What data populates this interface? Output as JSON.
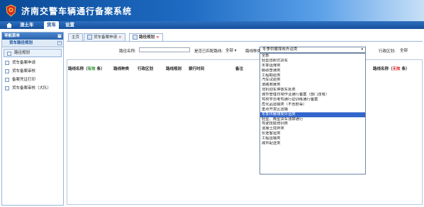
{
  "app": {
    "title": "济南交警车辆通行备案系统"
  },
  "nav": {
    "items": [
      {
        "label": "渣土车",
        "active": false
      },
      {
        "label": "货车",
        "active": true
      },
      {
        "label": "设置",
        "active": false
      }
    ]
  },
  "sidebar": {
    "header": "导航菜单",
    "section": "货车路径规划",
    "items": [
      {
        "label": "路径规划",
        "active": true
      },
      {
        "label": "货车备案申请"
      },
      {
        "label": "货车备案审核"
      },
      {
        "label": "备案凭证打印"
      },
      {
        "label": "货车备案审核（大队）"
      }
    ]
  },
  "tabs": [
    {
      "label": "主页",
      "closable": false
    },
    {
      "label": "货车备案申请",
      "closable": true
    },
    {
      "label": "路径规划",
      "closable": true,
      "active": true
    }
  ],
  "filters": {
    "route_name_label": "路径名称:",
    "match_label": "是否已匹配路线:",
    "match_value": "全部",
    "type_label": "路线种类:",
    "type_value": "冬季供暖煤炭外运类",
    "district_label": "行政区划:",
    "district_value": "全部"
  },
  "grid": {
    "col_route_name_prefix": "路线名称（",
    "col_route_name_valid": "有效",
    "col_route_name_suffix": " 条）",
    "col_type": "路线种类",
    "col_district": "行政区划",
    "col_rule": "路线规则",
    "col_time": "禁行时间",
    "col_note": "备注",
    "col_right_prefix": "路线名称（",
    "col_right_invalid": "无效",
    "col_right_suffix": " 条）"
  },
  "dropdown": {
    "options": [
      "全部",
      "轻型自卸式货车",
      "冬季运煤类",
      "邮政普通类",
      "工程勘验类",
      "汽车试验类",
      "道路救援类",
      "非机动车停放车处类",
      "城市管理日常作业通行备案（部门自有）",
      "驾校学员考驾通行证训练通行备案",
      "危化品运输类（不含剧毒）",
      "重点开发区运输",
      "冬季供暖煤炭外运类",
      "轻型、微型货车违禁通行",
      "驾驶技能培训类",
      "混凝土搅拌类",
      "长途客运类",
      "工程运输类",
      "城市配送类"
    ],
    "highlighted_index": 12
  },
  "colors": {
    "banner": "#1f6cc4",
    "nav": "#14509b",
    "highlight": "#3366cc",
    "valid": "#2a8a2a",
    "invalid": "#d22222"
  }
}
